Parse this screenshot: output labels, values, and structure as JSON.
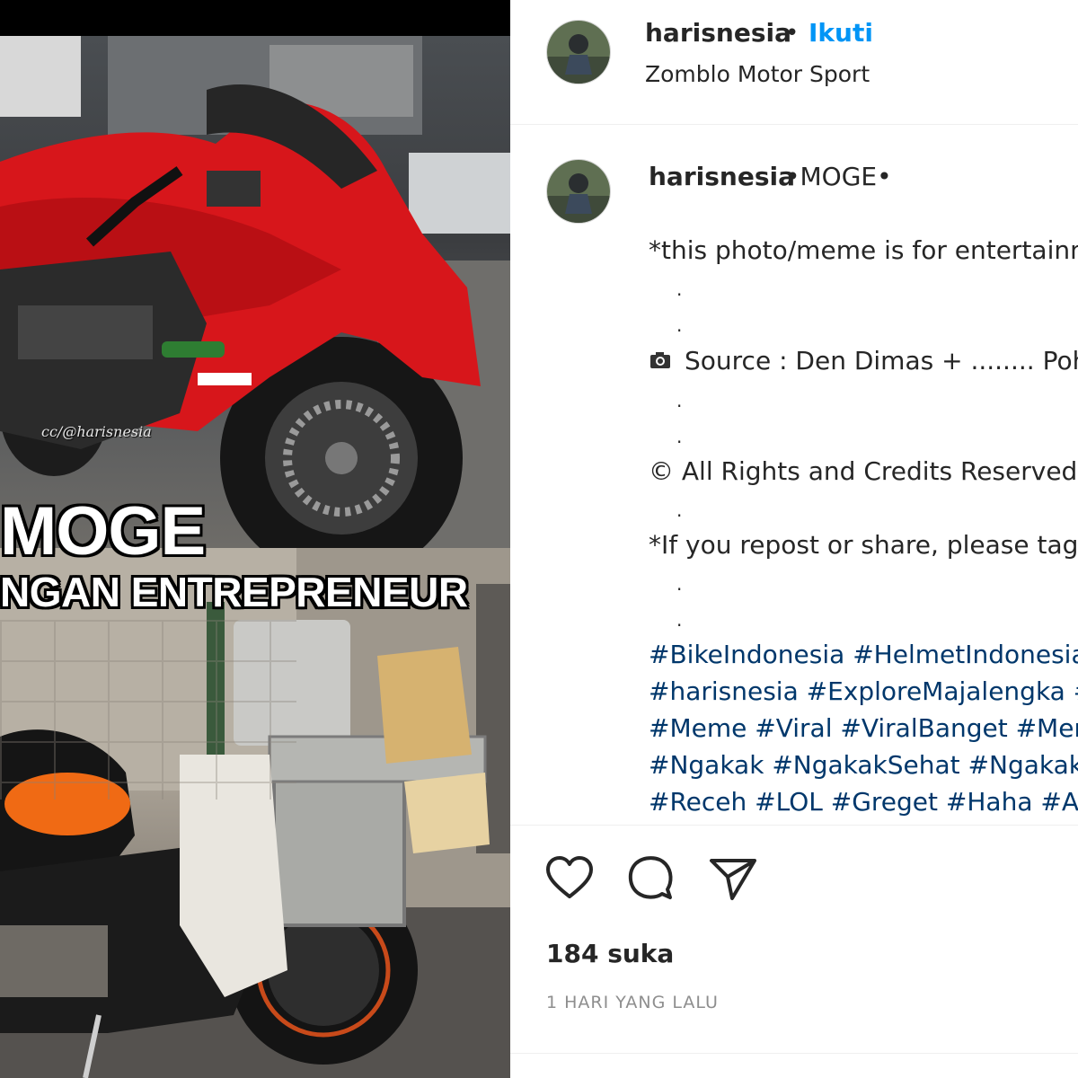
{
  "image": {
    "caption_main": "MOGE",
    "caption_sub": "NGAN ENTREPRENEUR",
    "watermark": "cc/@harisnesia"
  },
  "header": {
    "username": "harisnesia",
    "separator": "•",
    "follow_label": "Ikuti",
    "location": "Zomblo Motor Sport"
  },
  "caption": {
    "username": "harisnesia",
    "title": "•MOGE•",
    "line_disclaimer": "*this photo/meme is for entertainm",
    "line_source": "Source : Den Dimas + ........ Poho",
    "line_rights": "© All Rights and Credits Reserved",
    "line_repost": "*If you repost or share, please tag",
    "bullet": "."
  },
  "hashtags": [
    "#BikeIndonesia #HelmetIndonesia",
    "#harisnesia #ExploreMajalengka #",
    "#Meme #Viral #ViralBanget #Mem",
    "#Ngakak #NgakakSehat #Ngakak",
    "#Receh #LOL #Greget #Haha #Aw"
  ],
  "stats": {
    "likes": "184 suka",
    "time": "1 HARI YANG LALU"
  },
  "colors": {
    "follow": "#0095f6",
    "hashtag": "#00376b",
    "muted": "#8e8e8e",
    "text": "#262626"
  },
  "icons": {
    "like": "heart-icon",
    "comment": "comment-icon",
    "share": "share-icon",
    "camera": "camera-icon"
  }
}
